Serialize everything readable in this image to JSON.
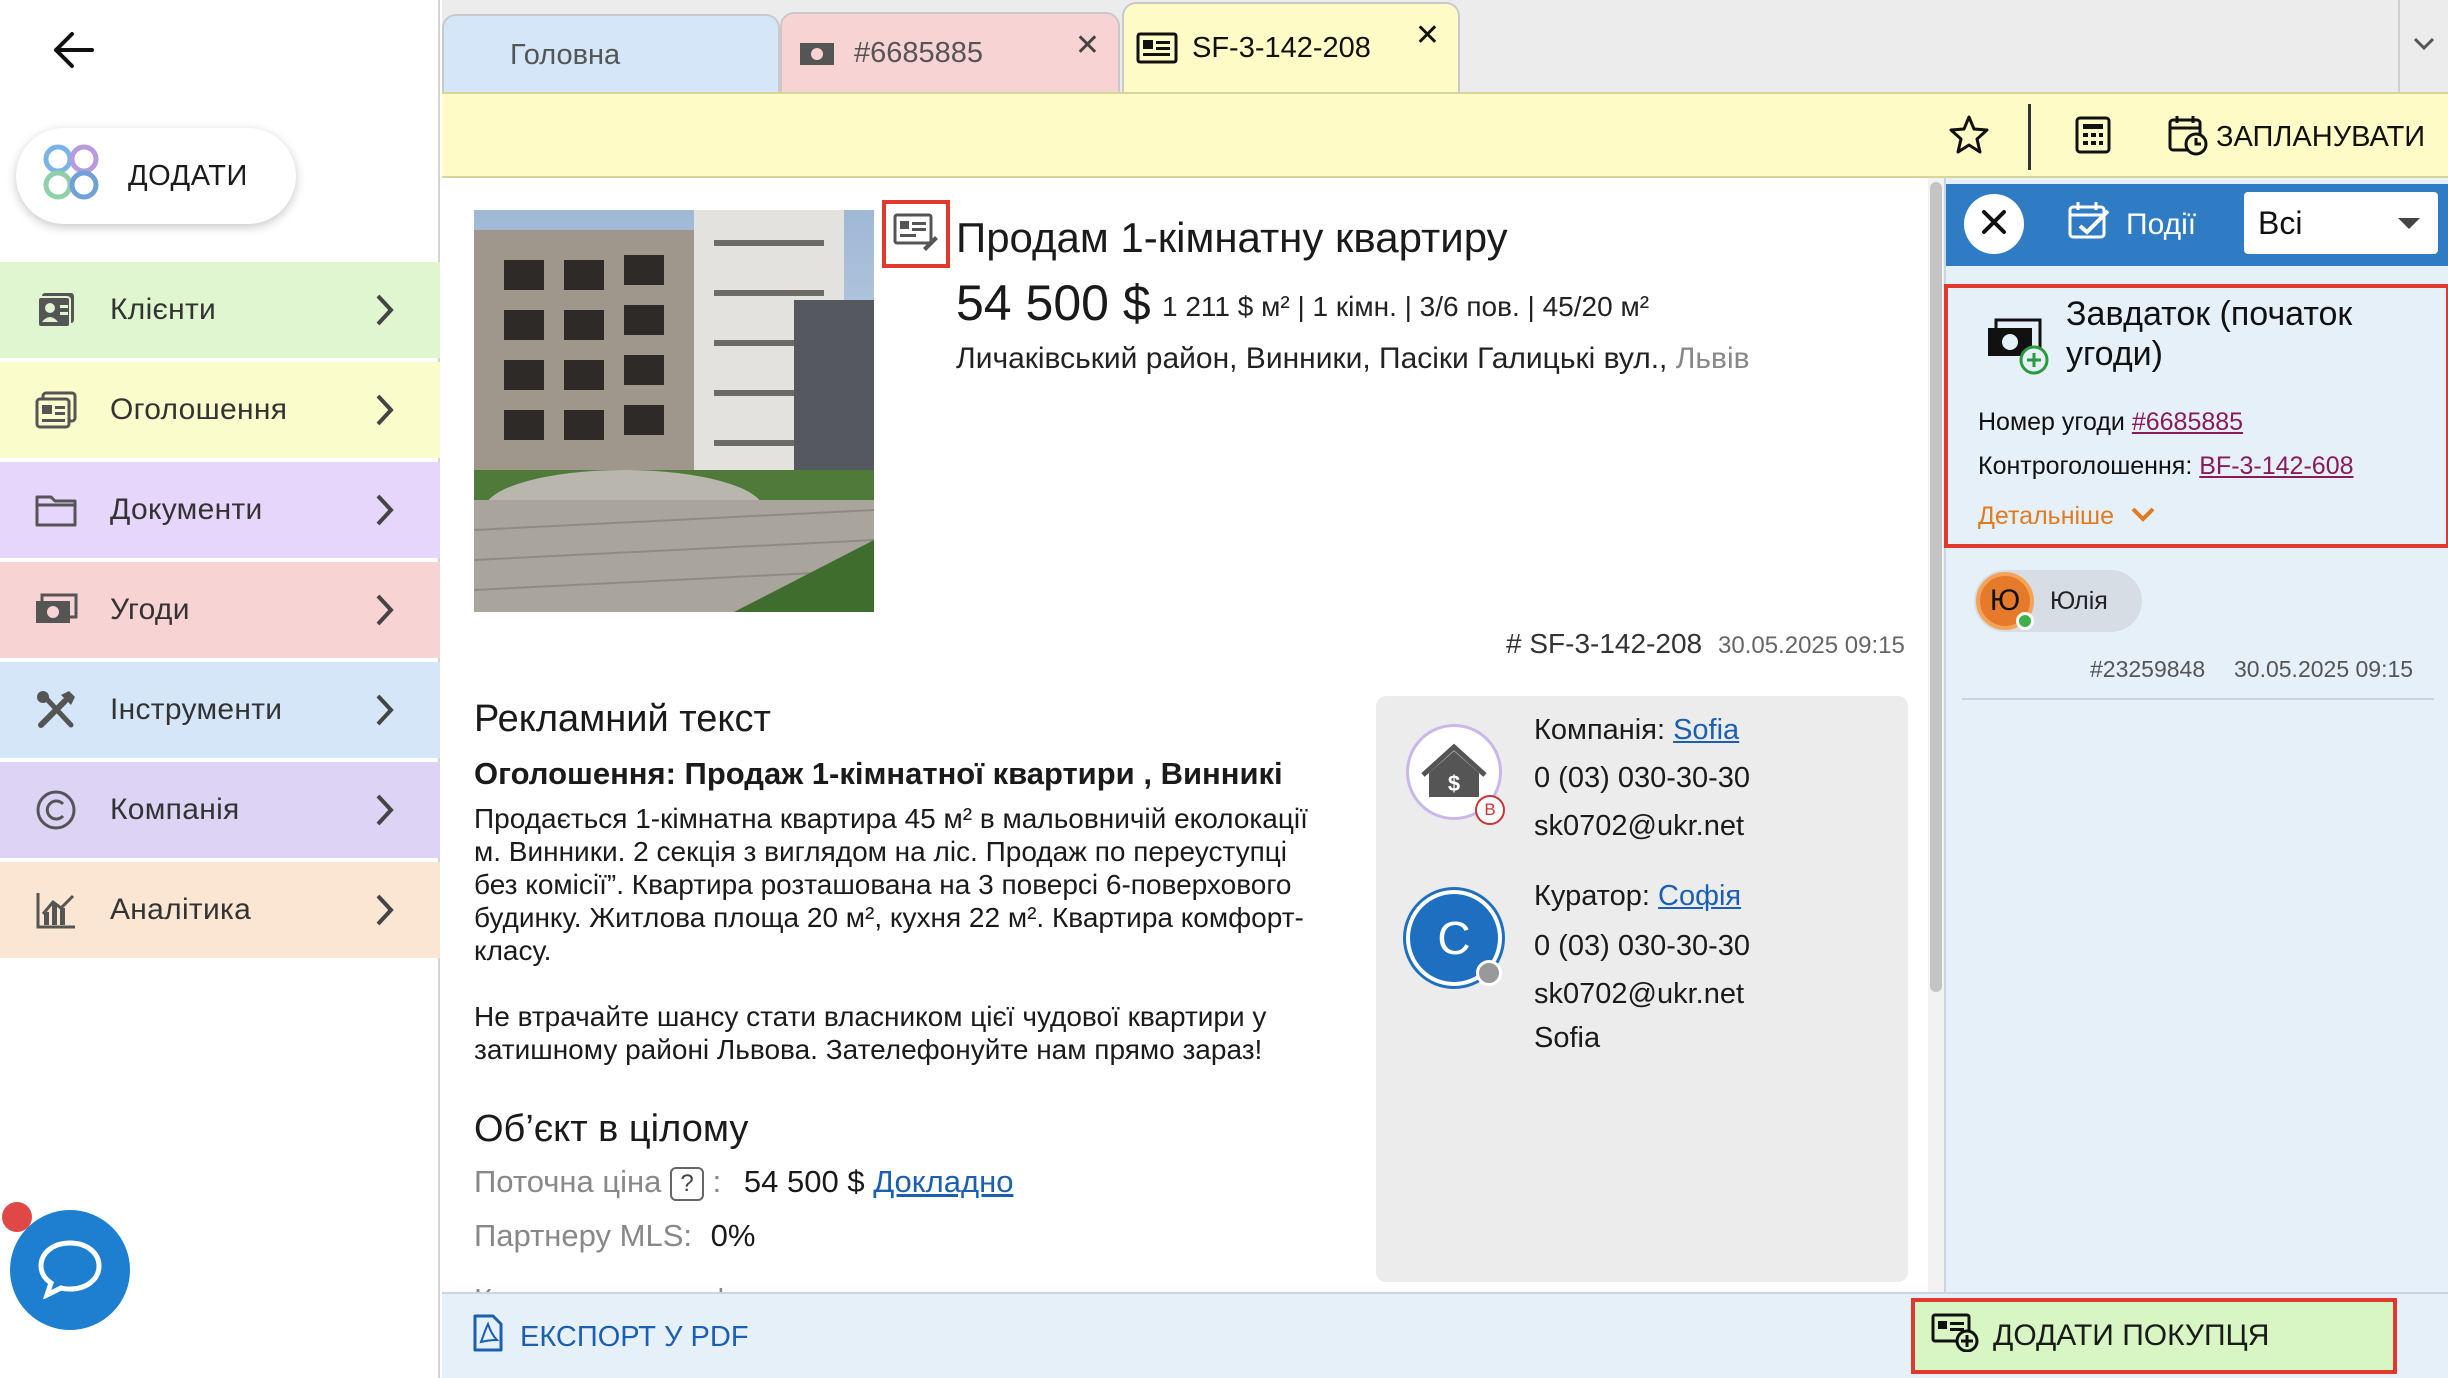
{
  "sidebar": {
    "add_label": "ДОДАТИ",
    "items": [
      {
        "label": "Клієнти",
        "color": "#dff6d0",
        "icon": "client-card-icon"
      },
      {
        "label": "Оголошення",
        "color": "#fbfccb",
        "icon": "listing-icon"
      },
      {
        "label": "Документи",
        "color": "#e7d6fb",
        "icon": "folder-icon"
      },
      {
        "label": "Угоди",
        "color": "#f8d3d3",
        "icon": "money-icon"
      },
      {
        "label": "Інструменти",
        "color": "#d5e6f8",
        "icon": "tools-icon"
      },
      {
        "label": "Компанія",
        "color": "#ddd3f5",
        "icon": "copyright-icon"
      },
      {
        "label": "Аналітика",
        "color": "#fae6d2",
        "icon": "analytics-icon"
      }
    ]
  },
  "tabs": [
    {
      "label": "Головна",
      "color": "#d5e6f8"
    },
    {
      "label": "#6685885",
      "color": "#f8d3d3"
    },
    {
      "label": "SF-3-142-208",
      "color": "#fefbc6"
    }
  ],
  "toolbar": {
    "schedule_label": "ЗАПЛАНУВАТИ"
  },
  "listing": {
    "title": "Продам 1-кімнатну квартиру",
    "price": "54 500 $",
    "details": "1 211 $ м² | 1 кімн. | 3/6 пов. | 45/20 м²",
    "address": "Личаківський район, Винники, Пасіки Галицькі вул.,",
    "city": "Львів",
    "code": "# SF-3-142-208",
    "date": "30.05.2025 09:15"
  },
  "ad": {
    "heading": "Рекламний текст",
    "subheading": "Оголошення: Продаж 1-кімнатної квартири , Винникі",
    "body": "Продається 1-кімнатна квартира 45 м² в мальовничій еколокації\nм. Винники. 2 секція з виглядом на ліс. Продаж по переуступці\nбез комісії”. Квартира розташована на 3 поверсі 6-поверхового\nбудинку. Житлова площа 20 м², кухня 22 м². Квартира комфорт-\nкласу.\n\nНе втрачайте шансу стати власником цієї чудової квартири у\nзатишному районі Львова. Зателефонуйте нам прямо зараз!"
  },
  "contact": {
    "company_label": "Компанія:",
    "company_name": "Sofia",
    "company_phone": "0 (03) 030-30-30",
    "company_email": "sk0702@ukr.net",
    "company_badge": "B",
    "curator_label": "Куратор:",
    "curator_name": "Софія",
    "curator_initial": "С",
    "curator_phone": "0 (03) 030-30-30",
    "curator_email": "sk0702@ukr.net",
    "curator_company": "Sofia"
  },
  "object": {
    "heading": "Об’єкт в цілому",
    "price_label": "Поточна ціна",
    "help": "?",
    "price_sep": ":",
    "price_value": "54 500 $",
    "price_link": "Докладно",
    "mls_label": "Партнеру MLS:",
    "mls_value": "0%",
    "cut_text": "Клас житла: комфорт"
  },
  "bottom": {
    "export_label": "ЕКСПОРТ У PDF",
    "add_buyer_label": "ДОДАТИ ПОКУПЦЯ"
  },
  "rpanel": {
    "events_label": "Події",
    "filter_value": "Всі",
    "deal_title": "Завдаток (початок угоди)",
    "deal_number_label": "Номер угоди",
    "deal_number": "#6685885",
    "control_label": "Контроголошення:",
    "control_value": "BF-3-142-608",
    "more_label": "Детальніше",
    "user_initial": "Ю",
    "user_name": "Юлія",
    "event_id": "#23259848",
    "event_date": "30.05.2025 09:15"
  },
  "colors": {
    "accent_blue": "#2f7bc4",
    "highlight_red": "#e03a2f",
    "link_blue": "#1a5fb4",
    "deal_link": "#8a1a5a",
    "more_orange": "#e07b20"
  }
}
